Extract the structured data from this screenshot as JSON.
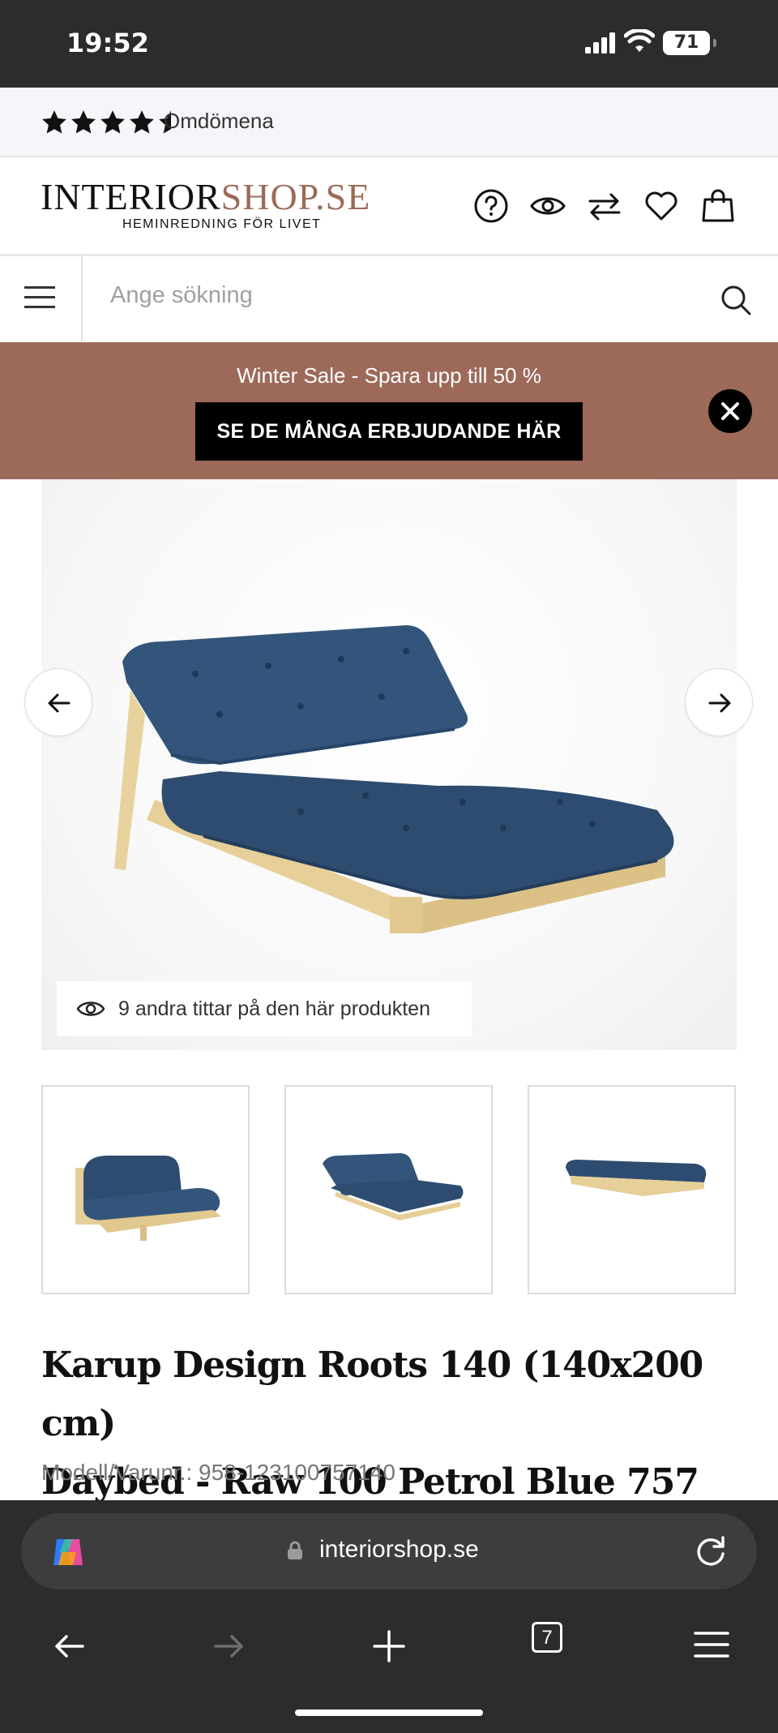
{
  "status_bar": {
    "time": "19:52",
    "battery": "71"
  },
  "reviews": {
    "rating_stars": 4.5,
    "label": "Omdömena"
  },
  "header": {
    "logo_part1": "INTERIOR",
    "logo_part2": "SHOP.SE",
    "logo_tagline": "HEMINREDNING FÖR LIVET",
    "icons": [
      "help-icon",
      "eye-icon",
      "compare-icon",
      "heart-icon",
      "bag-icon"
    ]
  },
  "search": {
    "placeholder": "Ange sökning"
  },
  "promo": {
    "text": "Winter Sale - Spara upp till 50 %",
    "cta": "SE DE MÅNGA ERBJUDANDE HÄR"
  },
  "gallery": {
    "viewers_text": "9 andra tittar på den här produkten",
    "thumbnail_count": 3
  },
  "product": {
    "title_line1": "Karup Design Roots 140 (140x200 cm)",
    "title_line2": "Daybed - Raw 100 Petrol Blue 757",
    "sku": "Modell/Varunr.: 958-123100757140"
  },
  "browser": {
    "url": "interiorshop.se",
    "tab_count": "7"
  },
  "colors": {
    "brand_copper": "#9c6a58",
    "promo_bg": "#9d6a5a",
    "sofa_blue": "#2c4a6e",
    "wood": "#e6cf98"
  }
}
